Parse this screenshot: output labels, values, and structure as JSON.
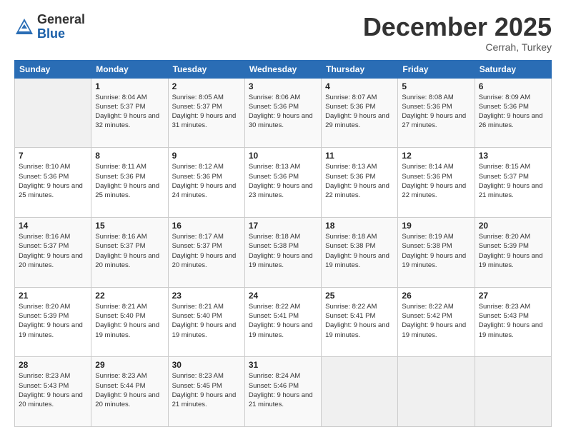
{
  "logo": {
    "general": "General",
    "blue": "Blue"
  },
  "title": "December 2025",
  "subtitle": "Cerrah, Turkey",
  "days_header": [
    "Sunday",
    "Monday",
    "Tuesday",
    "Wednesday",
    "Thursday",
    "Friday",
    "Saturday"
  ],
  "weeks": [
    [
      {
        "day": "",
        "sunrise": "",
        "sunset": "",
        "daylight": ""
      },
      {
        "day": "1",
        "sunrise": "Sunrise: 8:04 AM",
        "sunset": "Sunset: 5:37 PM",
        "daylight": "Daylight: 9 hours and 32 minutes."
      },
      {
        "day": "2",
        "sunrise": "Sunrise: 8:05 AM",
        "sunset": "Sunset: 5:37 PM",
        "daylight": "Daylight: 9 hours and 31 minutes."
      },
      {
        "day": "3",
        "sunrise": "Sunrise: 8:06 AM",
        "sunset": "Sunset: 5:36 PM",
        "daylight": "Daylight: 9 hours and 30 minutes."
      },
      {
        "day": "4",
        "sunrise": "Sunrise: 8:07 AM",
        "sunset": "Sunset: 5:36 PM",
        "daylight": "Daylight: 9 hours and 29 minutes."
      },
      {
        "day": "5",
        "sunrise": "Sunrise: 8:08 AM",
        "sunset": "Sunset: 5:36 PM",
        "daylight": "Daylight: 9 hours and 27 minutes."
      },
      {
        "day": "6",
        "sunrise": "Sunrise: 8:09 AM",
        "sunset": "Sunset: 5:36 PM",
        "daylight": "Daylight: 9 hours and 26 minutes."
      }
    ],
    [
      {
        "day": "7",
        "sunrise": "Sunrise: 8:10 AM",
        "sunset": "Sunset: 5:36 PM",
        "daylight": "Daylight: 9 hours and 25 minutes."
      },
      {
        "day": "8",
        "sunrise": "Sunrise: 8:11 AM",
        "sunset": "Sunset: 5:36 PM",
        "daylight": "Daylight: 9 hours and 25 minutes."
      },
      {
        "day": "9",
        "sunrise": "Sunrise: 8:12 AM",
        "sunset": "Sunset: 5:36 PM",
        "daylight": "Daylight: 9 hours and 24 minutes."
      },
      {
        "day": "10",
        "sunrise": "Sunrise: 8:13 AM",
        "sunset": "Sunset: 5:36 PM",
        "daylight": "Daylight: 9 hours and 23 minutes."
      },
      {
        "day": "11",
        "sunrise": "Sunrise: 8:13 AM",
        "sunset": "Sunset: 5:36 PM",
        "daylight": "Daylight: 9 hours and 22 minutes."
      },
      {
        "day": "12",
        "sunrise": "Sunrise: 8:14 AM",
        "sunset": "Sunset: 5:36 PM",
        "daylight": "Daylight: 9 hours and 22 minutes."
      },
      {
        "day": "13",
        "sunrise": "Sunrise: 8:15 AM",
        "sunset": "Sunset: 5:37 PM",
        "daylight": "Daylight: 9 hours and 21 minutes."
      }
    ],
    [
      {
        "day": "14",
        "sunrise": "Sunrise: 8:16 AM",
        "sunset": "Sunset: 5:37 PM",
        "daylight": "Daylight: 9 hours and 20 minutes."
      },
      {
        "day": "15",
        "sunrise": "Sunrise: 8:16 AM",
        "sunset": "Sunset: 5:37 PM",
        "daylight": "Daylight: 9 hours and 20 minutes."
      },
      {
        "day": "16",
        "sunrise": "Sunrise: 8:17 AM",
        "sunset": "Sunset: 5:37 PM",
        "daylight": "Daylight: 9 hours and 20 minutes."
      },
      {
        "day": "17",
        "sunrise": "Sunrise: 8:18 AM",
        "sunset": "Sunset: 5:38 PM",
        "daylight": "Daylight: 9 hours and 19 minutes."
      },
      {
        "day": "18",
        "sunrise": "Sunrise: 8:18 AM",
        "sunset": "Sunset: 5:38 PM",
        "daylight": "Daylight: 9 hours and 19 minutes."
      },
      {
        "day": "19",
        "sunrise": "Sunrise: 8:19 AM",
        "sunset": "Sunset: 5:38 PM",
        "daylight": "Daylight: 9 hours and 19 minutes."
      },
      {
        "day": "20",
        "sunrise": "Sunrise: 8:20 AM",
        "sunset": "Sunset: 5:39 PM",
        "daylight": "Daylight: 9 hours and 19 minutes."
      }
    ],
    [
      {
        "day": "21",
        "sunrise": "Sunrise: 8:20 AM",
        "sunset": "Sunset: 5:39 PM",
        "daylight": "Daylight: 9 hours and 19 minutes."
      },
      {
        "day": "22",
        "sunrise": "Sunrise: 8:21 AM",
        "sunset": "Sunset: 5:40 PM",
        "daylight": "Daylight: 9 hours and 19 minutes."
      },
      {
        "day": "23",
        "sunrise": "Sunrise: 8:21 AM",
        "sunset": "Sunset: 5:40 PM",
        "daylight": "Daylight: 9 hours and 19 minutes."
      },
      {
        "day": "24",
        "sunrise": "Sunrise: 8:22 AM",
        "sunset": "Sunset: 5:41 PM",
        "daylight": "Daylight: 9 hours and 19 minutes."
      },
      {
        "day": "25",
        "sunrise": "Sunrise: 8:22 AM",
        "sunset": "Sunset: 5:41 PM",
        "daylight": "Daylight: 9 hours and 19 minutes."
      },
      {
        "day": "26",
        "sunrise": "Sunrise: 8:22 AM",
        "sunset": "Sunset: 5:42 PM",
        "daylight": "Daylight: 9 hours and 19 minutes."
      },
      {
        "day": "27",
        "sunrise": "Sunrise: 8:23 AM",
        "sunset": "Sunset: 5:43 PM",
        "daylight": "Daylight: 9 hours and 19 minutes."
      }
    ],
    [
      {
        "day": "28",
        "sunrise": "Sunrise: 8:23 AM",
        "sunset": "Sunset: 5:43 PM",
        "daylight": "Daylight: 9 hours and 20 minutes."
      },
      {
        "day": "29",
        "sunrise": "Sunrise: 8:23 AM",
        "sunset": "Sunset: 5:44 PM",
        "daylight": "Daylight: 9 hours and 20 minutes."
      },
      {
        "day": "30",
        "sunrise": "Sunrise: 8:23 AM",
        "sunset": "Sunset: 5:45 PM",
        "daylight": "Daylight: 9 hours and 21 minutes."
      },
      {
        "day": "31",
        "sunrise": "Sunrise: 8:24 AM",
        "sunset": "Sunset: 5:46 PM",
        "daylight": "Daylight: 9 hours and 21 minutes."
      },
      {
        "day": "",
        "sunrise": "",
        "sunset": "",
        "daylight": ""
      },
      {
        "day": "",
        "sunrise": "",
        "sunset": "",
        "daylight": ""
      },
      {
        "day": "",
        "sunrise": "",
        "sunset": "",
        "daylight": ""
      }
    ]
  ]
}
